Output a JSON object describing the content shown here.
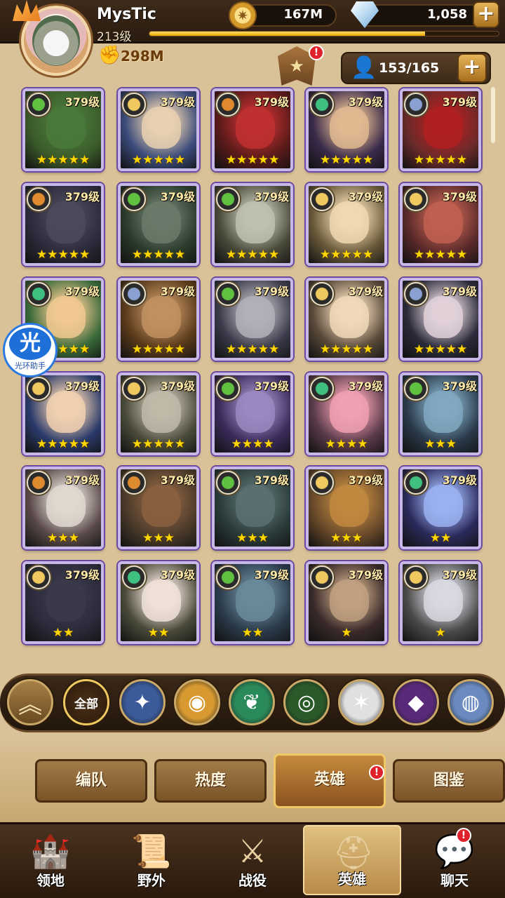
{
  "player": {
    "name": "MysTic",
    "level": "213级",
    "xp_fraction": 0.79,
    "power": "298M"
  },
  "currency": {
    "gold": "167M",
    "gems": "1,058",
    "gold_icon": "gold-coin-icon",
    "gem_icon": "diamond-icon"
  },
  "roster": {
    "count": "153/165"
  },
  "rank_badge": {
    "notice": "!"
  },
  "heroes": [
    {
      "level": "379级",
      "stars": "★★★★★",
      "faction": "graveborn",
      "bg": "#3b5a2a",
      "face": "#4a7a3a"
    },
    {
      "level": "379级",
      "stars": "★★★★★",
      "faction": "lightbearer",
      "bg": "#3a4a7a",
      "face": "#e8d0b0"
    },
    {
      "level": "379级",
      "stars": "★★★★★",
      "faction": "mauler",
      "bg": "#5a1a1a",
      "face": "#c03030"
    },
    {
      "level": "379级",
      "stars": "★★★★★",
      "faction": "wilder",
      "bg": "#3a2a4a",
      "face": "#e0b890"
    },
    {
      "level": "379级",
      "stars": "★★★★★",
      "faction": "dimensional",
      "bg": "#6a2a2a",
      "face": "#b02020"
    },
    {
      "level": "379级",
      "stars": "★★★★★",
      "faction": "mauler",
      "bg": "#2a2a3a",
      "face": "#4a4a5a"
    },
    {
      "level": "379级",
      "stars": "★★★★★",
      "faction": "graveborn",
      "bg": "#2a3a2a",
      "face": "#6a7a6a"
    },
    {
      "level": "379级",
      "stars": "★★★★★",
      "faction": "graveborn",
      "bg": "#4a4a3a",
      "face": "#c0c0b0"
    },
    {
      "level": "379级",
      "stars": "★★★★★",
      "faction": "lightbearer",
      "bg": "#6a5a3a",
      "face": "#f0d8b0"
    },
    {
      "level": "379级",
      "stars": "★★★★★",
      "faction": "lightbearer",
      "bg": "#5a2a2a",
      "face": "#c06050"
    },
    {
      "level": "379级",
      "stars": "★★★★★",
      "faction": "wilder",
      "bg": "#3a6a3a",
      "face": "#f0c890"
    },
    {
      "level": "379级",
      "stars": "★★★★★",
      "faction": "dimensional",
      "bg": "#5a3a1a",
      "face": "#c09060"
    },
    {
      "level": "379级",
      "stars": "★★★★★",
      "faction": "graveborn",
      "bg": "#3a3a4a",
      "face": "#b0b0b8"
    },
    {
      "level": "379级",
      "stars": "★★★★★",
      "faction": "lightbearer",
      "bg": "#5a4a3a",
      "face": "#f0d8b8"
    },
    {
      "level": "379级",
      "stars": "★★★★★",
      "faction": "dimensional",
      "bg": "#2a2a3a",
      "face": "#e0d0d8"
    },
    {
      "level": "379级",
      "stars": "★★★★★",
      "faction": "lightbearer",
      "bg": "#2a3a6a",
      "face": "#f0d0b0"
    },
    {
      "level": "379级",
      "stars": "★★★★★",
      "faction": "lightbearer",
      "bg": "#4a4a3a",
      "face": "#c0b8a8"
    },
    {
      "level": "379级",
      "stars": "★★★★",
      "faction": "graveborn",
      "bg": "#3a2a5a",
      "face": "#9a88c0"
    },
    {
      "level": "379级",
      "stars": "★★★★",
      "faction": "wilder",
      "bg": "#5a3a4a",
      "face": "#f0a0b0"
    },
    {
      "level": "379级",
      "stars": "★★★",
      "faction": "graveborn",
      "bg": "#2a3a4a",
      "face": "#80a8c0"
    },
    {
      "level": "379级",
      "stars": "★★★",
      "faction": "mauler",
      "bg": "#5a4a4a",
      "face": "#e0d8d0"
    },
    {
      "level": "379级",
      "stars": "★★★",
      "faction": "mauler",
      "bg": "#4a3a2a",
      "face": "#8a6040"
    },
    {
      "level": "379级",
      "stars": "★★★",
      "faction": "graveborn",
      "bg": "#2a3a3a",
      "face": "#5a7070"
    },
    {
      "level": "379级",
      "stars": "★★★",
      "faction": "lightbearer",
      "bg": "#6a4a2a",
      "face": "#c08840"
    },
    {
      "level": "379级",
      "stars": "★★",
      "faction": "wilder",
      "bg": "#2a2a5a",
      "face": "#9ab0f0"
    },
    {
      "level": "379级",
      "stars": "★★",
      "faction": "lightbearer",
      "bg": "#2a2a3a",
      "face": "#3a3a4a"
    },
    {
      "level": "379级",
      "stars": "★★",
      "faction": "wilder",
      "bg": "#4a4a3a",
      "face": "#f0e0d8"
    },
    {
      "level": "379级",
      "stars": "★★",
      "faction": "graveborn",
      "bg": "#2a3a4a",
      "face": "#6a8a9a"
    },
    {
      "level": "379级",
      "stars": "★",
      "faction": "lightbearer",
      "bg": "#3a2a2a",
      "face": "#c0a080"
    },
    {
      "level": "379级",
      "stars": "★",
      "faction": "lightbearer",
      "bg": "#4a4a4a",
      "face": "#d8d8e0"
    }
  ],
  "faction_colors": {
    "lightbearer": "#f0c860",
    "mauler": "#e08a30",
    "wilder": "#40c080",
    "graveborn": "#60c040",
    "dimensional": "#8aa0d0"
  },
  "filters": {
    "collapse_icon": "double-chevron-up-icon",
    "all_label": "全部",
    "factions": [
      {
        "name": "lightbearer-icon",
        "color": "#3a5a9a",
        "glyph": "✦"
      },
      {
        "name": "mauler-icon",
        "color": "#d89a30",
        "glyph": "◉"
      },
      {
        "name": "wilder-icon",
        "color": "#2a8a5a",
        "glyph": "❦"
      },
      {
        "name": "graveborn-icon",
        "color": "#2a5a2a",
        "glyph": "◎"
      },
      {
        "name": "celestial-icon",
        "color": "#e0e0e0",
        "glyph": "✶"
      },
      {
        "name": "hypogean-icon",
        "color": "#5a2a7a",
        "glyph": "◆"
      },
      {
        "name": "dimensional-icon",
        "color": "#6a8ac0",
        "glyph": "◍"
      }
    ]
  },
  "tabs": [
    {
      "label": "编队",
      "active": false
    },
    {
      "label": "热度",
      "active": false
    },
    {
      "label": "英雄",
      "active": true,
      "notice": "!"
    },
    {
      "label": "图鉴",
      "active": false
    }
  ],
  "nav": [
    {
      "label": "领地",
      "icon": "castle-icon",
      "glyph": "🏰",
      "active": false
    },
    {
      "label": "野外",
      "icon": "map-scroll-icon",
      "glyph": "📜",
      "active": false
    },
    {
      "label": "战役",
      "icon": "crossed-swords-icon",
      "glyph": "⚔",
      "active": false
    },
    {
      "label": "英雄",
      "icon": "helmet-icon",
      "glyph": "⛑",
      "active": true
    },
    {
      "label": "聊天",
      "icon": "chat-bubble-icon",
      "glyph": "💬",
      "active": false,
      "notice": "!"
    }
  ],
  "helper": {
    "glyph": "光",
    "label": "光环助手"
  }
}
